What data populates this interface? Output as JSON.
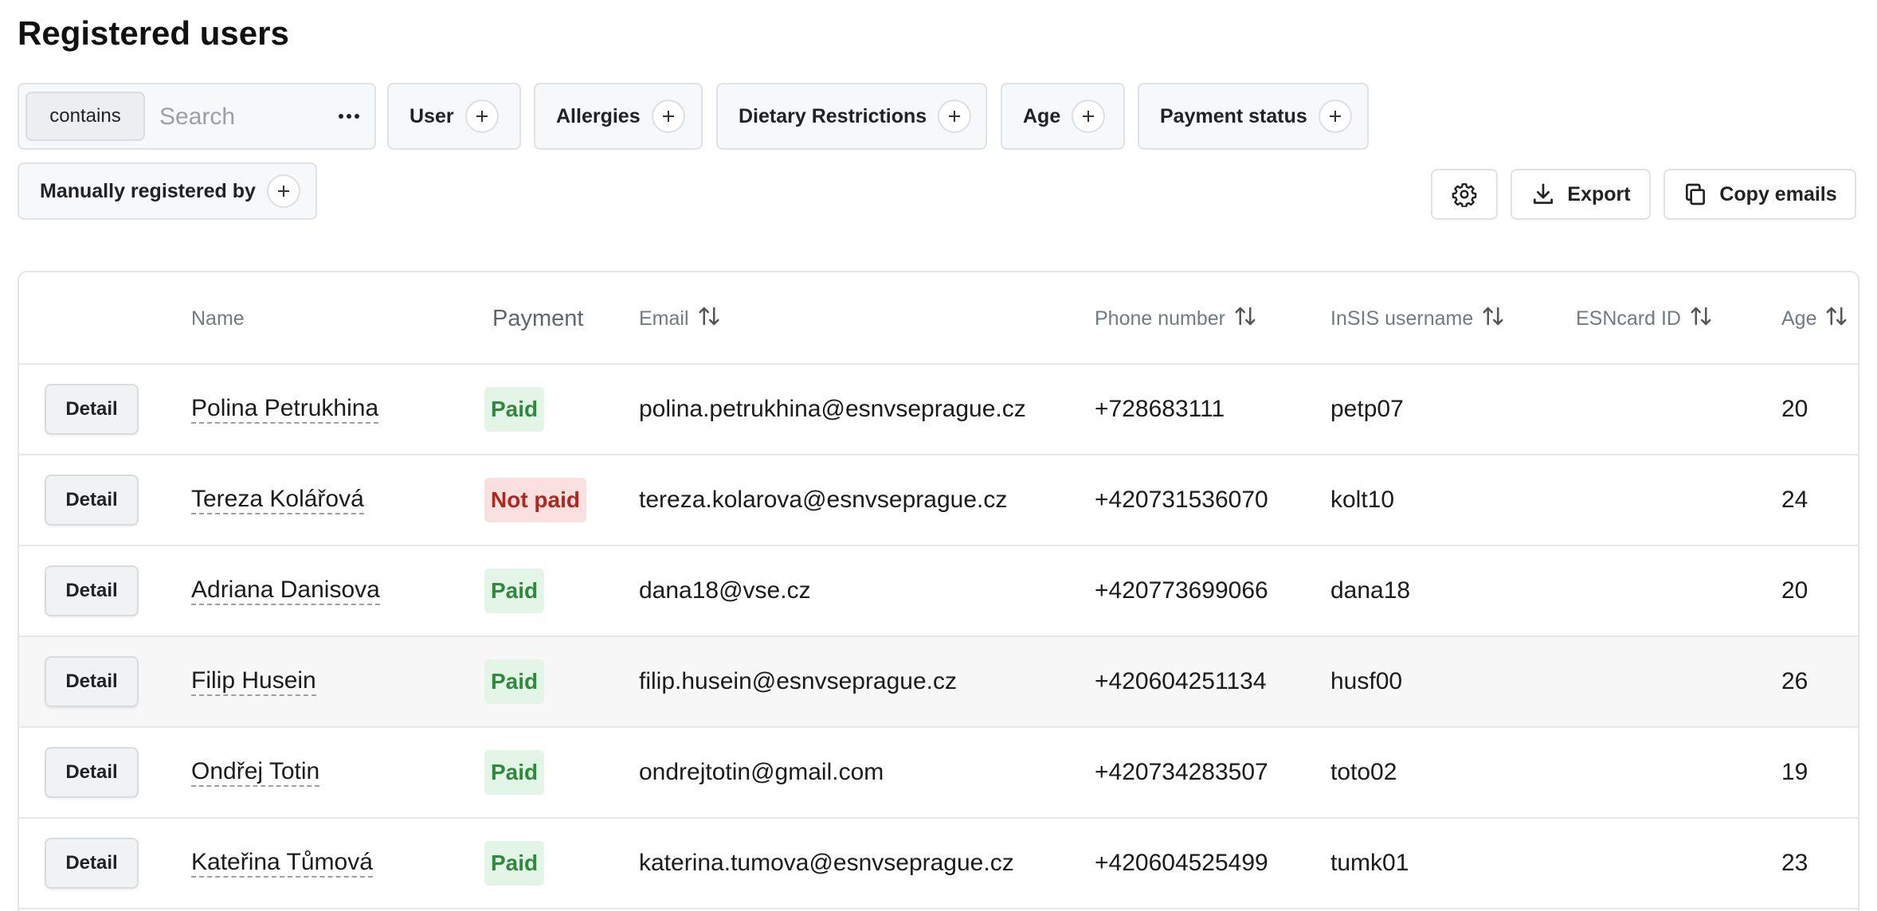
{
  "page": {
    "title": "Registered users"
  },
  "search": {
    "mode": "contains",
    "placeholder": "Search",
    "value": ""
  },
  "filters": {
    "user": "User",
    "allergies": "Allergies",
    "dietary": "Dietary Restrictions",
    "age": "Age",
    "payment_status": "Payment status",
    "manually_registered": "Manually registered by"
  },
  "actions": {
    "export": "Export",
    "copy_emails": "Copy emails"
  },
  "table": {
    "headers": {
      "name": "Name",
      "payment": "Payment",
      "email": "Email",
      "phone": "Phone number",
      "insis": "InSIS username",
      "esncard": "ESNcard ID",
      "age": "Age"
    },
    "detail_label": "Detail",
    "rows": [
      {
        "name": "Polina Petrukhina",
        "payment": "Paid",
        "email": "polina.petrukhina@esnvseprague.cz",
        "phone": "+728683111",
        "insis": "petp07",
        "esncard": "",
        "age": "20"
      },
      {
        "name": "Tereza Kolářová",
        "payment": "Not paid",
        "email": "tereza.kolarova@esnvseprague.cz",
        "phone": "+420731536070",
        "insis": "kolt10",
        "esncard": "",
        "age": "24"
      },
      {
        "name": "Adriana Danisova",
        "payment": "Paid",
        "email": "dana18@vse.cz",
        "phone": "+420773699066",
        "insis": "dana18",
        "esncard": "",
        "age": "20"
      },
      {
        "name": "Filip Husein",
        "payment": "Paid",
        "email": "filip.husein@esnvseprague.cz",
        "phone": "+420604251134",
        "insis": "husf00",
        "esncard": "",
        "age": "26"
      },
      {
        "name": "Ondřej Totin",
        "payment": "Paid",
        "email": "ondrejtotin@gmail.com",
        "phone": "+420734283507",
        "insis": "toto02",
        "esncard": "",
        "age": "19"
      },
      {
        "name": "Kateřina Tůmová",
        "payment": "Paid",
        "email": "katerina.tumova@esnvseprague.cz",
        "phone": "+420604525499",
        "insis": "tumk01",
        "esncard": "",
        "age": "23"
      }
    ]
  },
  "colors": {
    "paid_bg": "#e3f5e6",
    "paid_text": "#2f8a3e",
    "notpaid_bg": "#fbe0e0",
    "notpaid_text": "#b3261e",
    "highlight_row": "#f7f7f7"
  },
  "icons": {
    "plus": "plus-icon",
    "more": "more-horizontal-icon",
    "settings": "gear-icon",
    "export": "download-icon",
    "copy": "copy-icon",
    "sort": "sort-arrows-icon"
  }
}
